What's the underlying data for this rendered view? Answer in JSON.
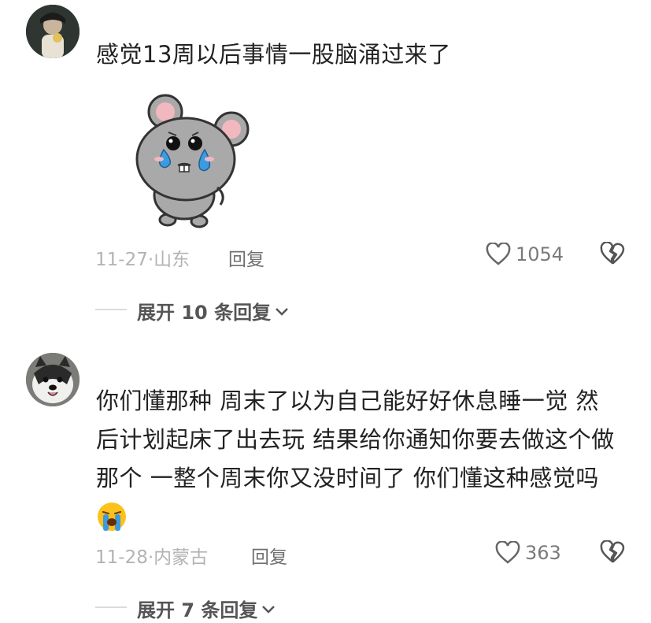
{
  "comments": [
    {
      "text": "感觉13周以后事情一股脑涌过来了",
      "sticker": "crying-mouse-sticker",
      "date": "11-27",
      "location": "山东",
      "reply_label": "回复",
      "likes": "1054",
      "expand_label": "展开 10 条回复"
    },
    {
      "text_lines": [
        "你们懂那种 周末了以为自己能好好休息睡一觉 然",
        "后计划起床了出去玩 结果给你通知你要去做这个做",
        "那个 一整个周末你又没时间了 你们懂这种感觉吗"
      ],
      "emoji": "😭",
      "date": "11-28",
      "location": "内蒙古",
      "reply_label": "回复",
      "likes": "363",
      "expand_label": "展开 7 条回复"
    }
  ],
  "icons": {
    "like": "heart-outline-icon",
    "dislike": "broken-heart-icon",
    "expand": "chevron-down-icon"
  },
  "colors": {
    "text": "#222222",
    "meta": "#b3b3b3",
    "divider": "#dcdcdc"
  }
}
